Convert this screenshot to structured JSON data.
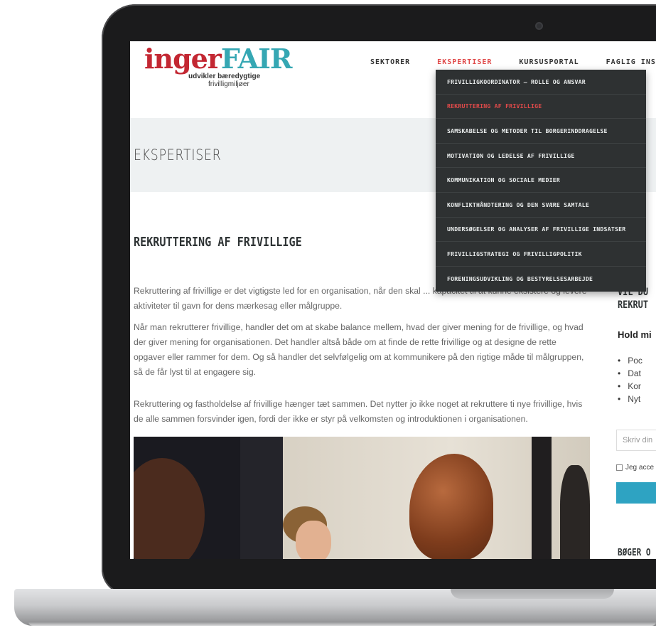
{
  "site": {
    "logo": {
      "word_a": "inger",
      "word_b": "FAIR",
      "tagline_1": "udvikler bæredygtige",
      "tagline_2": "frivilligmiljøer"
    }
  },
  "nav": {
    "items": [
      {
        "label": "SEKTORER"
      },
      {
        "label": "EKSPERTISER",
        "active": true
      },
      {
        "label": "KURSUSPORTAL"
      },
      {
        "label": "FAGLIG INSPIRAT"
      }
    ]
  },
  "dropdown": {
    "items": [
      {
        "label": "FRIVILLIGKOORDINATOR – ROLLE OG ANSVAR"
      },
      {
        "label": "REKRUTTERING AF FRIVILLIGE",
        "active": true
      },
      {
        "label": "SAMSKABELSE OG METODER TIL BORGERINDDRAGELSE"
      },
      {
        "label": "MOTIVATION OG LEDELSE AF FRIVILLIGE"
      },
      {
        "label": "KOMMUNIKATION OG SOCIALE MEDIER"
      },
      {
        "label": "KONFLIKTHÅNDTERING OG DEN SVÆRE SAMTALE"
      },
      {
        "label": "UNDERSØGELSER OG ANALYSER AF FRIVILLIGE INDSATSER"
      },
      {
        "label": "FRIVILLIGSTRATEGI OG FRIVILLIGPOLITIK"
      },
      {
        "label": "FORENINGSUDVIKLING OG BESTYRELSESARBEJDE"
      }
    ]
  },
  "banner": {
    "title": "EKSPERTISER"
  },
  "article": {
    "title": "REKRUTTERING AF FRIVILLIGE",
    "paragraphs": [
      "Rekruttering af frivillige er det vigtigste led for en organisation, når den skal ... kapacitet til at kunne eksistere og levere aktiviteter til gavn for dens mærkesag eller målgruppe.",
      "Når man rekrutterer frivillige, handler det om at skabe balance mellem, hvad der giver mening for de frivillige, og hvad der giver mening for organisationen. Det handler altså både om at finde de rette frivillige og at designe de rette opgaver eller rammer for dem. Og så handler det selvfølgelig om at kommunikere på den rigtige måde til målgruppen, så de får lyst til at engagere sig.",
      "Rekruttering og fastholdelse af frivillige hænger tæt sammen. Det nytter jo ikke noget at rekruttere ti nye frivillige, hvis de alle sammen forsvinder igen, fordi der ikke er styr på velkomsten og introduktionen i organisationen."
    ]
  },
  "sidebar": {
    "heading_1": "VIL DU",
    "heading_2": "REKRUT",
    "subheading": "Hold mi",
    "bullets": [
      "Poc",
      "Dat",
      "Kor",
      "Nyt"
    ],
    "input_placeholder": "Skriv din",
    "checkbox_label": "Jeg acce",
    "footer_heading": "BØGER O"
  }
}
